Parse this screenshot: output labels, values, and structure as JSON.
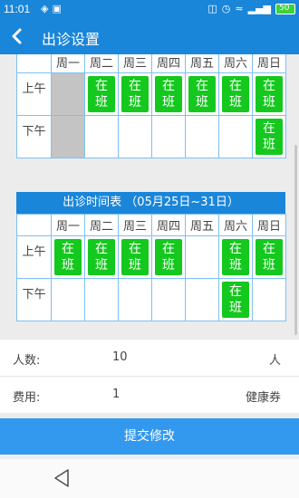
{
  "status_bar": {
    "time": "11:01",
    "battery": "50",
    "left_icons": [
      "chat-icon",
      "image-icon"
    ],
    "right_icons": [
      "vibrate-icon",
      "alarm-icon",
      "wifi-icon",
      "signal-icon",
      "battery-icon"
    ]
  },
  "header": {
    "title": "出诊设置"
  },
  "schedule_current": {
    "days": [
      "周一",
      "周二",
      "周三",
      "周四",
      "周五",
      "周六",
      "周日"
    ],
    "rows": [
      {
        "label": "上午",
        "cells": [
          "disabled",
          "在班",
          "在班",
          "在班",
          "在班",
          "在班",
          "在班"
        ]
      },
      {
        "label": "下午",
        "cells": [
          "disabled",
          "",
          "",
          "",
          "",
          "",
          "在班"
        ]
      }
    ]
  },
  "schedule_next": {
    "title": "出诊时间表 （05月25日~31日）",
    "days": [
      "周一",
      "周二",
      "周三",
      "周四",
      "周五",
      "周六",
      "周日"
    ],
    "rows": [
      {
        "label": "上午",
        "cells": [
          "在班",
          "在班",
          "在班",
          "在班",
          "",
          "在班",
          "在班"
        ]
      },
      {
        "label": "下午",
        "cells": [
          "",
          "",
          "",
          "",
          "",
          "在班",
          ""
        ]
      }
    ]
  },
  "form": {
    "count_label": "人数:",
    "count_value": "10",
    "count_unit": "人",
    "fee_label": "费用:",
    "fee_value": "1",
    "fee_unit": "健康券"
  },
  "submit_label": "提交修改",
  "colors": {
    "primary": "#1a86d9",
    "on_duty": "#15c81e",
    "disabled": "#c4c4c4",
    "submit": "#3399ee"
  }
}
